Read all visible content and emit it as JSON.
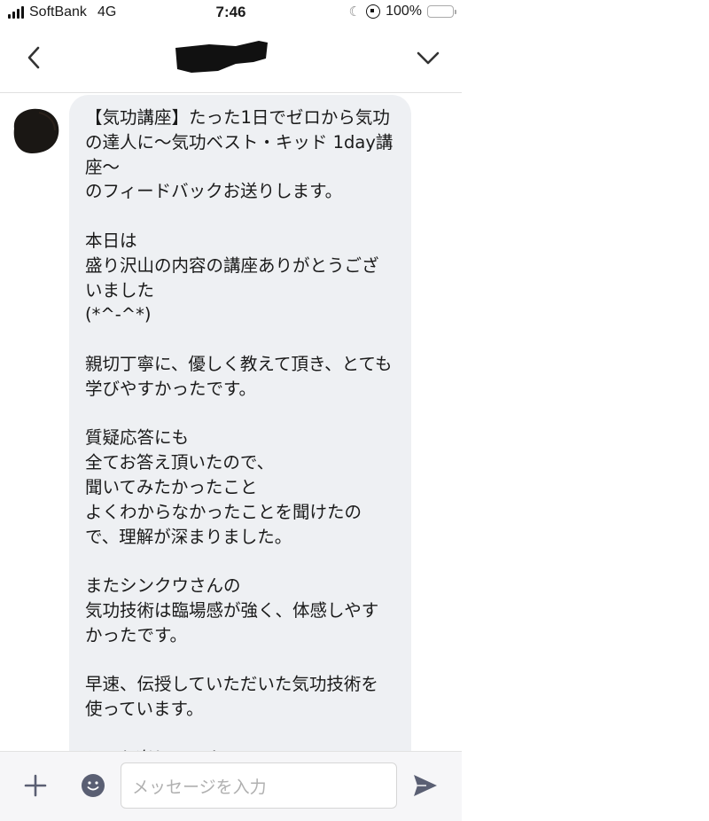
{
  "status_bar": {
    "carrier": "SoftBank",
    "network": "4G",
    "time": "7:46",
    "battery": "100%"
  },
  "header": {
    "title_redacted": true
  },
  "message": {
    "text": "【気功講座】たった1日でゼロから気功の達人に〜気功ベスト・キッド 1day講座〜\nのフィードバックお送りします。\n\n本日は\n盛り沢山の内容の講座ありがとうございました\n(*^-^*)\n\n親切丁寧に、優しく教えて頂き、とても学びやすかったです。\n\n質疑応答にも\n全てお答え頂いたので、\n聞いてみたかったこと\nよくわからなかったことを聞けたので、理解が深まりました。\n\nまたシンクウさんの\n気功技術は臨場感が強く、体感しやすかったです。\n\n早速、伝授していただいた気功技術を使っています。\n\nとても楽しいです。"
  },
  "input": {
    "placeholder": "メッセージを入力"
  },
  "icons": {
    "back": "chevron-left-icon",
    "menu": "chevron-down-icon",
    "add": "plus-icon",
    "emoji": "smiley-icon",
    "send": "send-icon"
  },
  "colors": {
    "bubble": "#eef0f3",
    "battery": "#f7c744",
    "icon": "#5a5f73"
  }
}
